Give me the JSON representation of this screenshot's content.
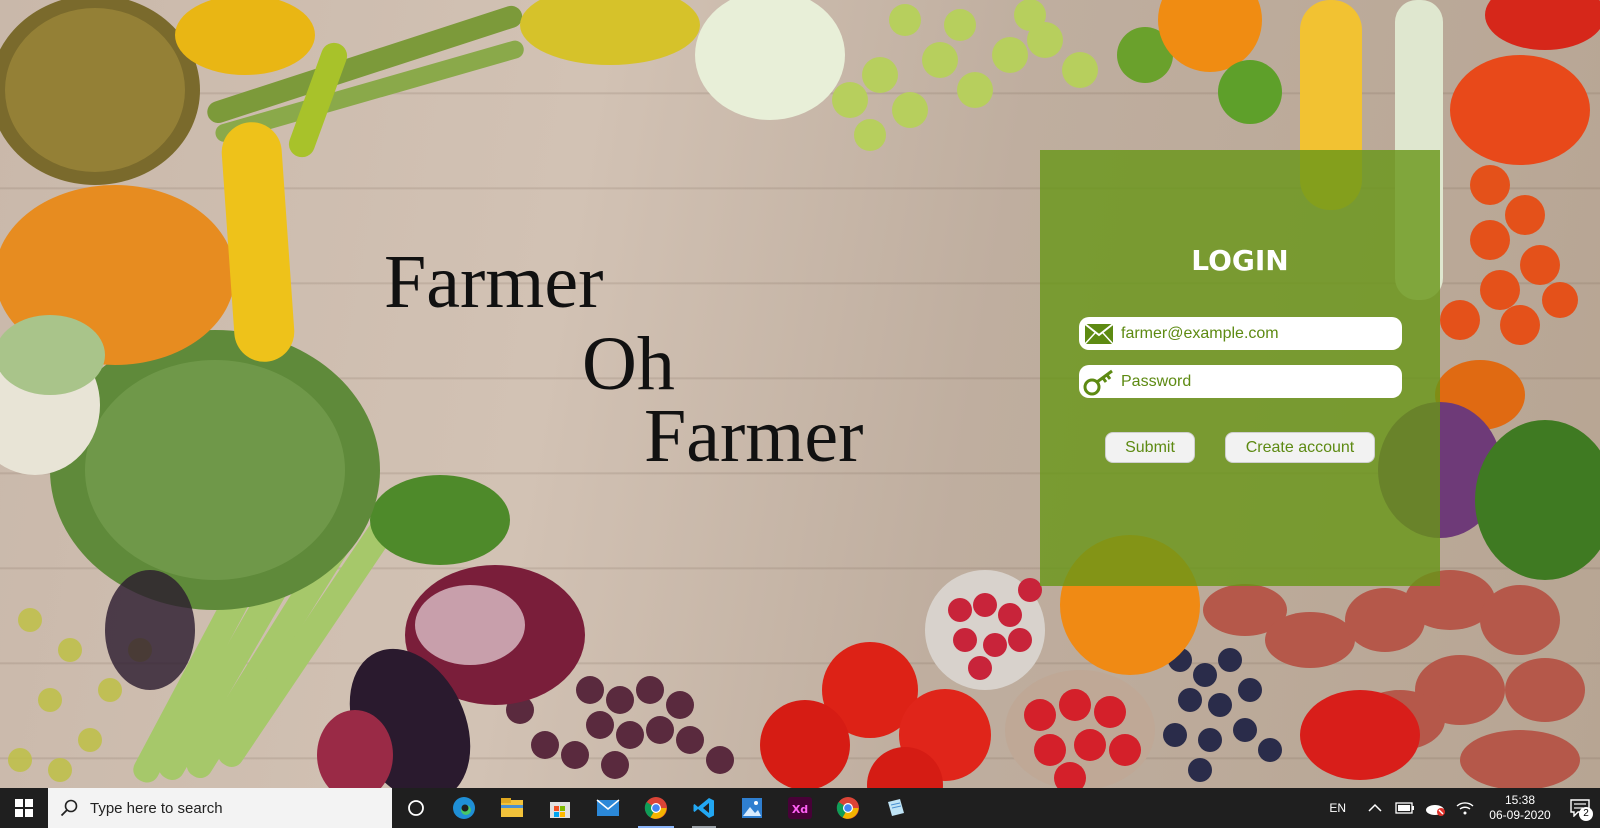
{
  "title": {
    "line1": "Farmer",
    "line2": "Oh",
    "line3": "Farmer"
  },
  "login": {
    "heading": "LOGIN",
    "email_placeholder": "farmer@example.com",
    "password_placeholder": "Password",
    "submit_label": "Submit",
    "create_label": "Create account",
    "email_icon": "envelope-icon",
    "password_icon": "key-icon"
  },
  "taskbar": {
    "search_placeholder": "Type here to search",
    "apps": [
      "cortana-icon",
      "edge-icon",
      "file-explorer-icon",
      "store-icon",
      "mail-icon",
      "chrome-icon",
      "vscode-icon",
      "photos-icon",
      "adobe-xd-icon",
      "chrome-icon",
      "notepad-icon"
    ],
    "language": "EN",
    "time": "15:38",
    "date": "06-09-2020",
    "notification_count": "2"
  },
  "colors": {
    "panel": "#68961699",
    "accent": "#5d8a12",
    "taskbar": "#1f1f1f"
  }
}
